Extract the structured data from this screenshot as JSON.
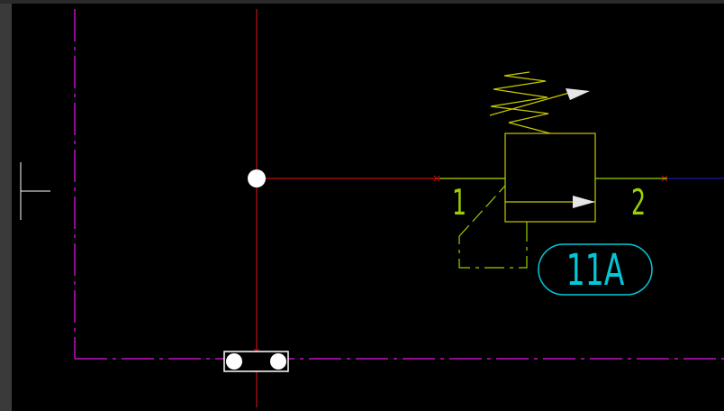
{
  "colors": {
    "background": "#000000",
    "frame_edge": "#3a3a3a",
    "boundary": "#c010c0",
    "pipe_red": "#c01010",
    "valve_yellow": "#c8c800",
    "pilot_green": "#9ad000",
    "tag_cyan": "#00c8d8",
    "pipe_blue": "#1818b0",
    "white": "#ffffff"
  },
  "valve": {
    "port_in_label": "1",
    "port_out_label": "2"
  },
  "tag": {
    "text": "11A"
  },
  "icons": [
    "spring-icon",
    "adjustable-arrow-icon",
    "flow-arrow-icon",
    "junction-dot-icon",
    "connector-icon"
  ]
}
